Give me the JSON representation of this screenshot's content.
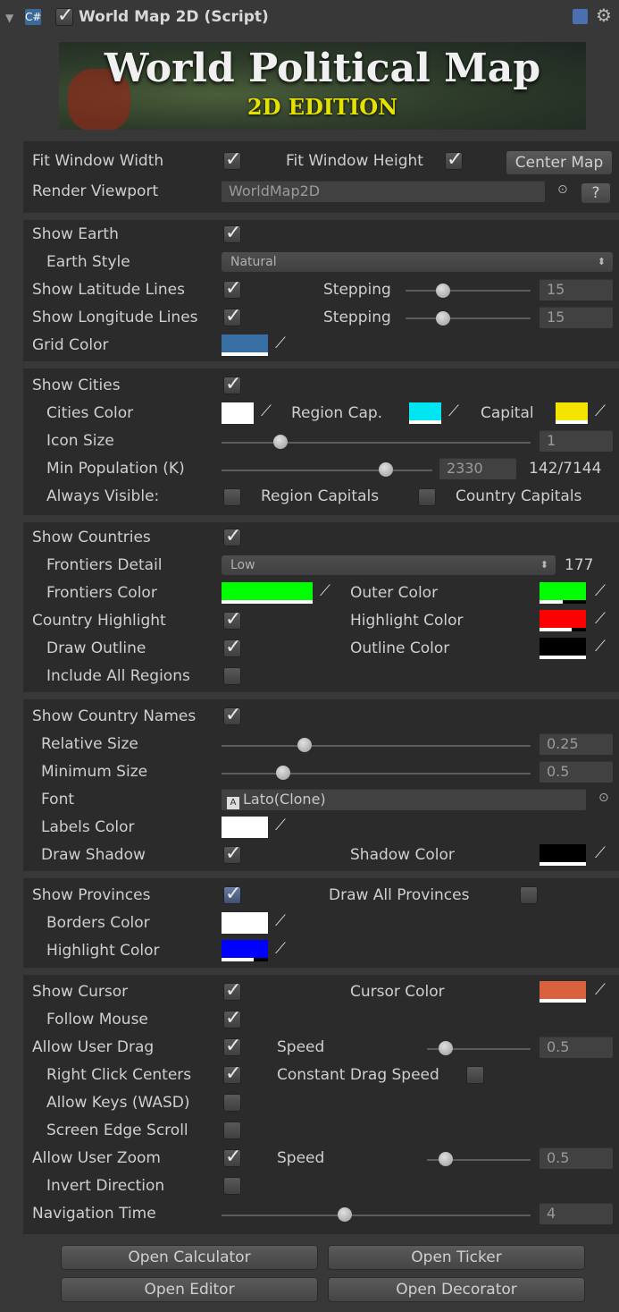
{
  "header": {
    "title": "World Map 2D (Script)",
    "foldout": "open"
  },
  "banner": {
    "title": "World Political Map",
    "subtitle": "2D EDITION"
  },
  "window": {
    "fit_width_label": "Fit Window Width",
    "fit_width": true,
    "fit_height_label": "Fit Window Height",
    "fit_height": true,
    "center_map_label": "Center Map",
    "render_viewport_label": "Render Viewport",
    "render_viewport_value": "WorldMap2D",
    "help_label": "?"
  },
  "earth": {
    "show_earth_label": "Show Earth",
    "show_earth": true,
    "earth_style_label": "Earth Style",
    "earth_style_value": "Natural",
    "lat_label": "Show Latitude Lines",
    "lat": true,
    "lat_stepping_label": "Stepping",
    "lat_stepping_value": "15",
    "lat_stepping_level": 0.3,
    "lon_label": "Show Longitude Lines",
    "lon": true,
    "lon_stepping_label": "Stepping",
    "lon_stepping_value": "15",
    "lon_stepping_level": 0.3,
    "grid_color_label": "Grid Color",
    "grid_color": "#3a6fa6"
  },
  "cities": {
    "show_cities_label": "Show Cities",
    "show_cities": true,
    "cities_color_label": "Cities Color",
    "cities_color": "#ffffff",
    "region_cap_label": "Region Cap.",
    "region_cap_color": "#00e6f0",
    "capital_label": "Capital",
    "capital_color": "#f5e400",
    "icon_size_label": "Icon Size",
    "icon_size_value": "1",
    "icon_size_level": 0.19,
    "min_pop_label": "Min Population (K)",
    "min_pop_value": "2330",
    "min_pop_level": 0.78,
    "min_pop_count": "142/7144",
    "always_visible_label": "Always Visible:",
    "region_capitals_label": "Region Capitals",
    "region_capitals": false,
    "country_capitals_label": "Country Capitals",
    "country_capitals": false
  },
  "countries": {
    "show_countries_label": "Show Countries",
    "show_countries": true,
    "frontiers_detail_label": "Frontiers Detail",
    "frontiers_detail_value": "Low",
    "frontiers_count": "177",
    "frontiers_color_label": "Frontiers Color",
    "frontiers_color": "#00ff00",
    "outer_color_label": "Outer Color",
    "outer_color": "#00ff00",
    "highlight_label": "Country Highlight",
    "highlight": true,
    "highlight_color_label": "Highlight Color",
    "highlight_color": "#ff0000",
    "draw_outline_label": "Draw Outline",
    "draw_outline": true,
    "outline_color_label": "Outline Color",
    "outline_color": "#000000",
    "include_regions_label": "Include All Regions",
    "include_regions": false
  },
  "names": {
    "show_names_label": "Show Country Names",
    "show_names": true,
    "relative_size_label": "Relative Size",
    "relative_size_value": "0.25",
    "relative_size_level": 0.27,
    "minimum_size_label": "Minimum Size",
    "minimum_size_value": "0.5",
    "minimum_size_level": 0.2,
    "font_label": "Font",
    "font_value": "Lato(Clone)",
    "labels_color_label": "Labels Color",
    "labels_color": "#ffffff",
    "draw_shadow_label": "Draw Shadow",
    "draw_shadow": true,
    "shadow_color_label": "Shadow Color",
    "shadow_color": "#000000"
  },
  "provinces": {
    "show_provinces_label": "Show Provinces",
    "show_provinces": true,
    "draw_all_label": "Draw All Provinces",
    "draw_all": false,
    "borders_color_label": "Borders Color",
    "borders_color": "#ffffff",
    "highlight_color_label": "Highlight Color",
    "highlight_color": "#0000ff"
  },
  "navigation": {
    "show_cursor_label": "Show Cursor",
    "show_cursor": true,
    "cursor_color_label": "Cursor Color",
    "cursor_color": "#d9613e",
    "follow_mouse_label": "Follow Mouse",
    "follow_mouse": true,
    "allow_drag_label": "Allow User Drag",
    "allow_drag": true,
    "drag_speed_label": "Speed",
    "drag_speed_value": "0.5",
    "drag_speed_level": 0.18,
    "right_click_label": "Right Click Centers",
    "right_click": true,
    "constant_drag_label": "Constant Drag Speed",
    "constant_drag": false,
    "allow_keys_label": "Allow Keys (WASD)",
    "allow_keys": false,
    "edge_scroll_label": "Screen Edge Scroll",
    "edge_scroll": false,
    "allow_zoom_label": "Allow User Zoom",
    "allow_zoom": true,
    "zoom_speed_label": "Speed",
    "zoom_speed_value": "0.5",
    "zoom_speed_level": 0.18,
    "invert_label": "Invert Direction",
    "invert": false,
    "nav_time_label": "Navigation Time",
    "nav_time_value": "4",
    "nav_time_level": 0.4
  },
  "buttons": {
    "open_calculator": "Open Calculator",
    "open_ticker": "Open Ticker",
    "open_editor": "Open Editor",
    "open_decorator": "Open Decorator"
  },
  "colors": {
    "panel_bg": "#383838",
    "section_bg": "#2b2b2b"
  }
}
